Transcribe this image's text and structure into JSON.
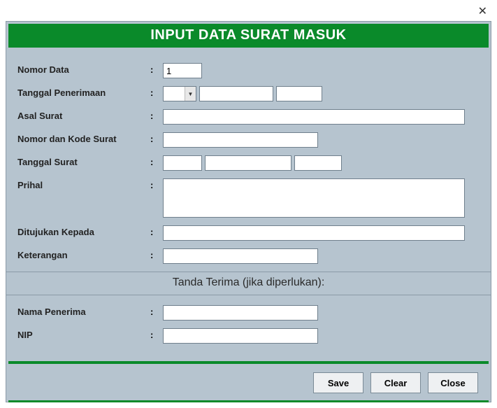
{
  "window": {
    "close_glyph": "✕"
  },
  "header": {
    "title": "INPUT DATA SURAT MASUK"
  },
  "labels": {
    "nomor_data": "Nomor Data",
    "tanggal_penerimaan": "Tanggal Penerimaan",
    "asal_surat": "Asal Surat",
    "nomor_kode_surat": "Nomor dan Kode Surat",
    "tanggal_surat": "Tanggal Surat",
    "prihal": "Prihal",
    "ditujukan_kepada": "Ditujukan Kepada",
    "keterangan": "Keterangan",
    "nama_penerima": "Nama Penerima",
    "nip": "NIP"
  },
  "section": {
    "tanda_terima": "Tanda Terima (jika diperlukan):"
  },
  "values": {
    "nomor_data": "1",
    "tgl_pen_1": "",
    "tgl_pen_2": "",
    "tgl_pen_3": "",
    "asal_surat": "",
    "nomor_kode_surat": "",
    "tgl_surat_1": "",
    "tgl_surat_2": "",
    "tgl_surat_3": "",
    "prihal": "",
    "ditujukan_kepada": "",
    "keterangan": "",
    "nama_penerima": "",
    "nip": ""
  },
  "buttons": {
    "save": "Save",
    "clear": "Clear",
    "close": "Close"
  },
  "colon": ":"
}
